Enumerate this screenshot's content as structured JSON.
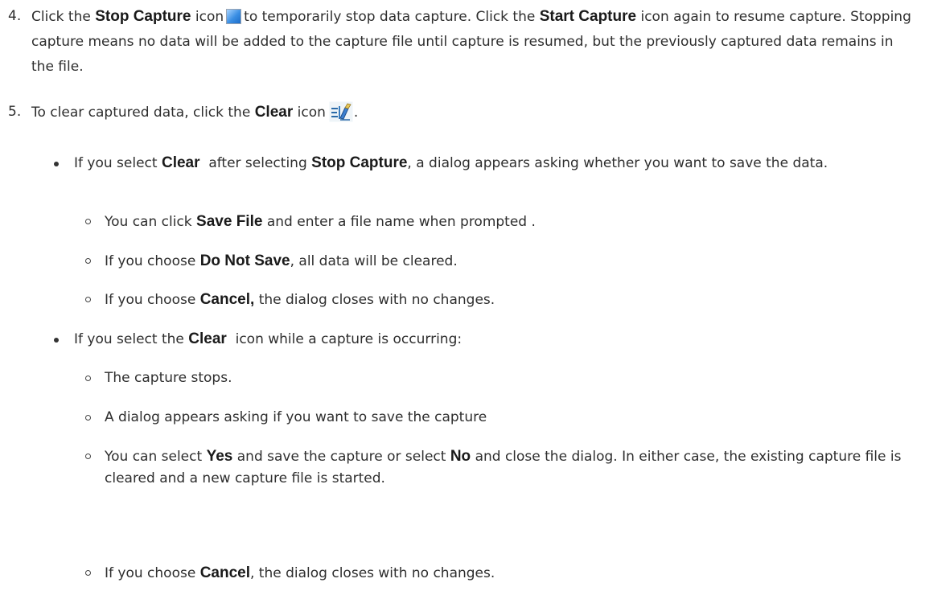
{
  "step4": {
    "number": "4.",
    "t1": "Click the",
    "b1": "Stop Capture",
    "t2": "icon",
    "stop_icon": "stop-square-icon",
    "t3": "to temporarily stop data capture. Click the",
    "b2": "Start Capture",
    "t4": "icon again to resume capture. Stopping capture means no data will be added to the capture file until capture is resumed, but the previously captured data remains in the file."
  },
  "step5": {
    "number": "5.",
    "t1": "To clear captured data, click the",
    "b1": "Clear",
    "t2": "icon",
    "clear_icon": "clear-capture-icon",
    "t3": "."
  },
  "bullet1": {
    "t1": "If you select",
    "b1": "Clear",
    "t2": "after selecting",
    "b2": "Stop Capture",
    "t3": ", a dialog appears asking whether you want to save the data.",
    "subs": {
      "s1": {
        "t1": "You can click",
        "b1": "Save File",
        "t2": "and enter a file name when prompted ."
      },
      "s2": {
        "t1": "If you choose",
        "b1": "Do Not Save",
        "t2": ", all data will be cleared."
      },
      "s3": {
        "t1": "If you choose",
        "b1": "Cancel,",
        "t2": "the dialog closes with no changes."
      }
    }
  },
  "bullet2": {
    "t1": "If you select the",
    "b1": "Clear",
    "t2": "icon while a capture is occurring:",
    "subs": {
      "s1": {
        "t1": "The capture stops."
      },
      "s2": {
        "t1": "A dialog appears asking if you want to save the capture"
      },
      "s3": {
        "t1": "You can select",
        "b1": "Yes",
        "t2": "and save the capture or select",
        "b2": "No",
        "t3": "and close the dialog.  In either case, the existing capture file is cleared and a new capture file is started."
      },
      "s4": {
        "t1": "If you choose",
        "b1": "Cancel",
        "t2": ", the dialog closes with no changes."
      }
    }
  }
}
